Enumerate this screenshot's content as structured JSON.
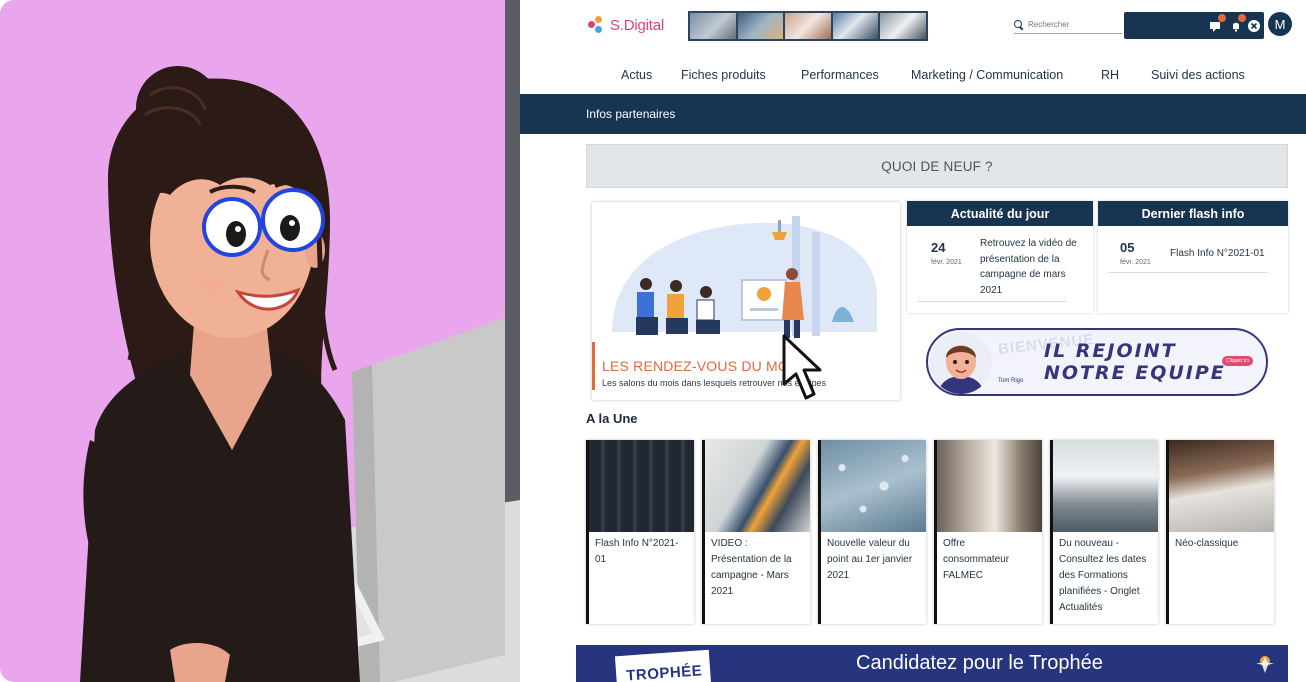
{
  "brand": {
    "name": "S.Digital",
    "color": "#d7447b"
  },
  "header": {
    "search_placeholder": "Rechercher",
    "user_initial": "M"
  },
  "main_nav": [
    "Actus",
    "Fiches produits",
    "Performances",
    "Marketing / Communication",
    "RH",
    "Suivi des actions"
  ],
  "sub_nav": {
    "item": "Infos partenaires"
  },
  "section_banner": "QUOI DE NEUF ?",
  "rendez_vous": {
    "title": "LES RENDEZ-VOUS DU MOIS",
    "subtitle": "Les salons du mois dans lesquels retrouver nos équipes"
  },
  "actualite": {
    "header": "Actualité du jour",
    "day": "24",
    "month": "févr. 2021",
    "lines": [
      "Retrouvez la vidéo de",
      "présentation de la",
      "campagne de mars",
      "2021"
    ]
  },
  "flash": {
    "header": "Dernier flash info",
    "day": "05",
    "month": "févr. 2021",
    "text": "Flash Info N°2021-01"
  },
  "recruitment": {
    "name": "Tom Rigo",
    "line1": "IL REJOINT",
    "line2": "NOTRE EQUIPE",
    "button": "Cliquez ici",
    "watermark": "BIENVENUE"
  },
  "a_la_une": {
    "title": "A la Une",
    "items": [
      {
        "lines": [
          "Flash Info N°2021-",
          "01"
        ]
      },
      {
        "lines": [
          "VIDEO :",
          "Présentation de la",
          "campagne - Mars",
          "2021"
        ]
      },
      {
        "lines": [
          "Nouvelle valeur du",
          "point au 1er janvier",
          "2021"
        ]
      },
      {
        "lines": [
          "Offre",
          "consommateur",
          "FALMEC"
        ]
      },
      {
        "lines": [
          "Du nouveau -",
          "Consultez les dates",
          "des Formations",
          "planifiées - Onglet",
          "Actualités"
        ]
      },
      {
        "lines": [
          "Néo-classique"
        ]
      }
    ]
  },
  "trophy_banner": {
    "logo_text": "TROPHÉE",
    "text": "Candidatez pour le Trophée"
  },
  "colors": {
    "navy": "#173451",
    "illustration_bg": "#e9a6ec",
    "accent_orange": "#e06a3b",
    "trophy_blue": "#27347e"
  }
}
